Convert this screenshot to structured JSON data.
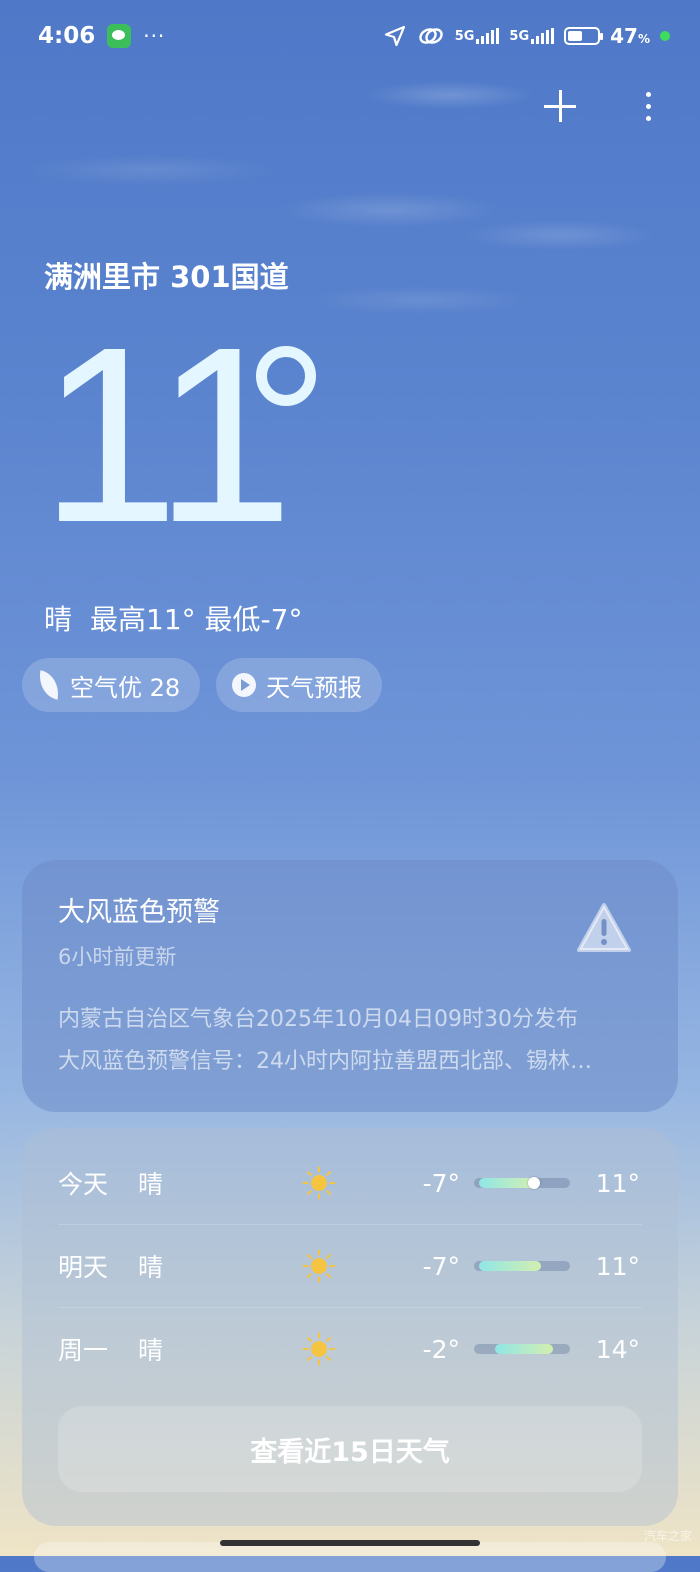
{
  "status_bar": {
    "time": "4:06",
    "dots": "···",
    "sig1_label": "5G",
    "sig2_label": "5G",
    "battery": "47",
    "battery_unit": "%"
  },
  "location": "满洲里市 301国道",
  "current": {
    "temp": "11",
    "condition": "晴",
    "high_low": "最高11° 最低-7°"
  },
  "chips": [
    {
      "label": "空气优 28",
      "icon": "leaf-icon"
    },
    {
      "label": "天气预报",
      "icon": "play-icon"
    }
  ],
  "alert": {
    "title": "大风蓝色预警",
    "updated": "6小时前更新",
    "line1": "内蒙古自治区气象台2025年10月04日09时30分发布",
    "line2": "大风蓝色预警信号：24小时内阿拉善盟西北部、锡林…",
    "icon": "warning-triangle-icon"
  },
  "forecast": [
    {
      "day": "今天",
      "weather": "晴",
      "icon": "sun-icon",
      "low": "-7°",
      "high": "11°",
      "range_start": 0.05,
      "range_end": 0.65,
      "current": 0.62
    },
    {
      "day": "明天",
      "weather": "晴",
      "icon": "sun-icon",
      "low": "-7°",
      "high": "11°",
      "range_start": 0.05,
      "range_end": 0.7
    },
    {
      "day": "周一",
      "weather": "晴",
      "icon": "sun-icon",
      "low": "-2°",
      "high": "14°",
      "range_start": 0.22,
      "range_end": 0.82
    }
  ],
  "forecast_button": "查看近15日天气",
  "watermark": "汽车之家",
  "colors": {
    "sun": "#f5c542",
    "temp_text": "#e4f6ff",
    "bar_gradient_start": "#8fe6e6",
    "bar_gradient_end": "#d4efb0"
  }
}
